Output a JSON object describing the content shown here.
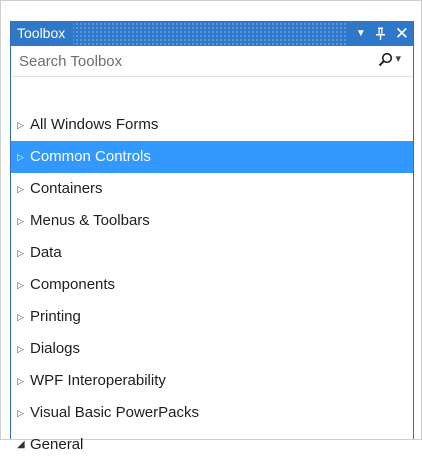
{
  "panel": {
    "title": "Toolbox",
    "buttons": {
      "menu": "▼",
      "pin": "pin-icon",
      "close": "✕"
    }
  },
  "search": {
    "placeholder": "Search Toolbox",
    "icon": "search-icon",
    "dropdown": "▾"
  },
  "items": [
    {
      "label": "All Windows Forms",
      "arrow": "▷",
      "expanded": false,
      "selected": false
    },
    {
      "label": "Common Controls",
      "arrow": "▷",
      "expanded": false,
      "selected": true
    },
    {
      "label": "Containers",
      "arrow": "▷",
      "expanded": false,
      "selected": false
    },
    {
      "label": "Menus & Toolbars",
      "arrow": "▷",
      "expanded": false,
      "selected": false
    },
    {
      "label": "Data",
      "arrow": "▷",
      "expanded": false,
      "selected": false
    },
    {
      "label": "Components",
      "arrow": "▷",
      "expanded": false,
      "selected": false
    },
    {
      "label": "Printing",
      "arrow": "▷",
      "expanded": false,
      "selected": false
    },
    {
      "label": "Dialogs",
      "arrow": "▷",
      "expanded": false,
      "selected": false
    },
    {
      "label": "WPF Interoperability",
      "arrow": "▷",
      "expanded": false,
      "selected": false
    },
    {
      "label": "Visual Basic PowerPacks",
      "arrow": "▷",
      "expanded": false,
      "selected": false
    },
    {
      "label": "General",
      "arrow": "◢",
      "expanded": true,
      "selected": false
    }
  ],
  "colors": {
    "titlebar": "#2f77c9",
    "selection": "#3399ff",
    "text": "#1e1e1e",
    "placeholder": "#6d6d6d"
  }
}
